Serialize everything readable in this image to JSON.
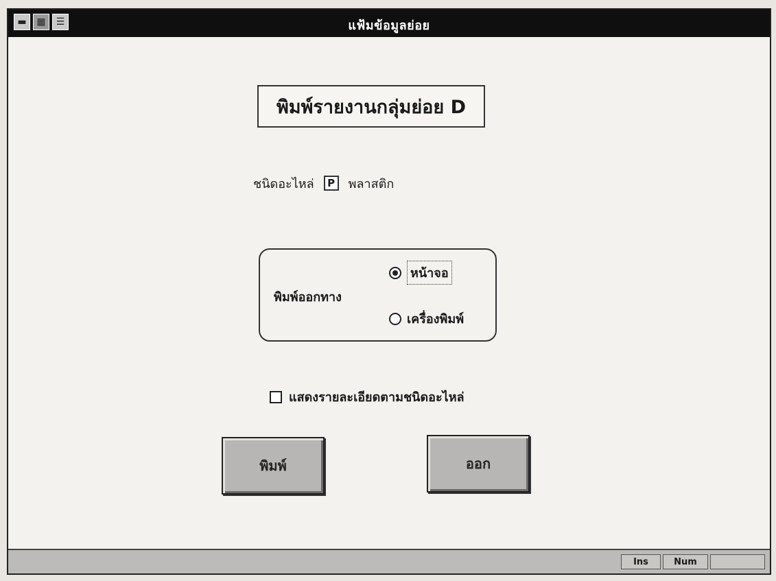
{
  "window": {
    "title": "แฟ้มข้อมูลย่อย"
  },
  "titlebar_buttons": [
    {
      "icon": "control-menu-icon",
      "glyph": "▬"
    },
    {
      "icon": "app-icon",
      "glyph": "▦"
    },
    {
      "icon": "list-icon",
      "glyph": "☰"
    }
  ],
  "report": {
    "title": "พิมพ์รายงานกลุ่มย่อย D"
  },
  "part_type": {
    "label": "ชนิดอะไหล่",
    "code": "P",
    "name": "พลาสติก"
  },
  "output": {
    "label": "พิมพ์ออกทาง",
    "options": [
      {
        "label": "หน้าจอ",
        "selected": true
      },
      {
        "label": "เครื่องพิมพ์",
        "selected": false
      }
    ]
  },
  "detail_checkbox": {
    "label": "แสดงรายละเอียดตามชนิดอะไหล่",
    "checked": false
  },
  "buttons": {
    "print": "พิมพ์",
    "exit": "ออก"
  },
  "statusbar": {
    "ins": "Ins",
    "num": "Num",
    "extra": ""
  },
  "colors": {
    "titlebar": "#0f0f0f",
    "button_face": "#b8b6b4",
    "window_bg": "#f4f2ee"
  }
}
